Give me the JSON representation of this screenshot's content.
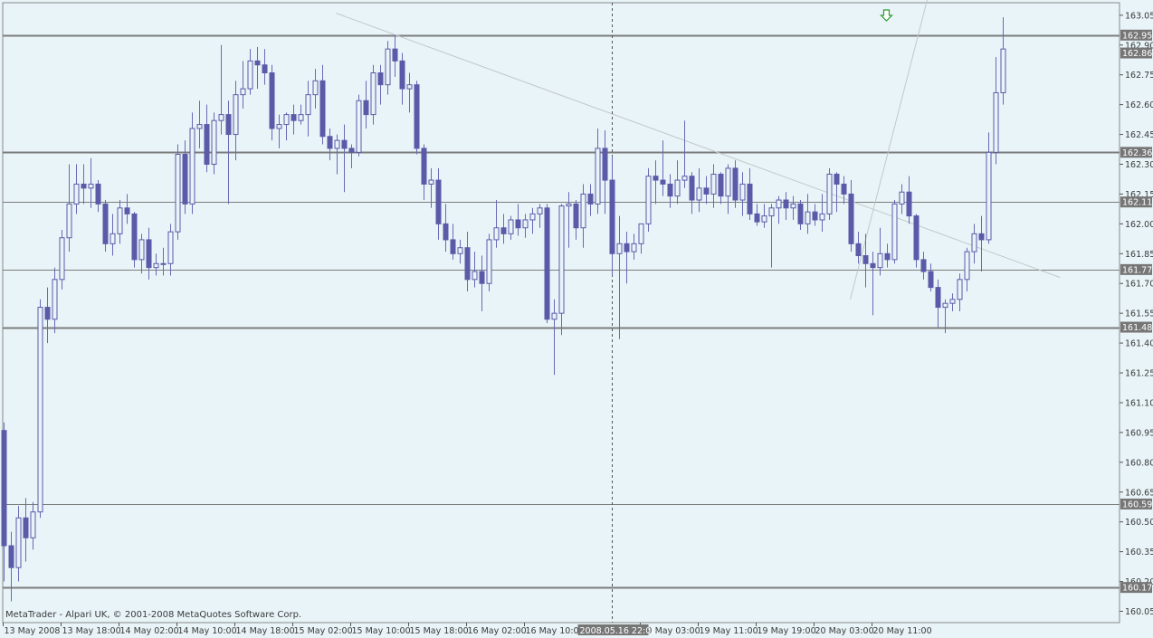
{
  "watermark": "MetaTrader - Alpari UK, © 2001-2008 MetaQuotes Software Corp.",
  "colors": {
    "background": "#e8f4f8",
    "candle_outline": "#5a5aa8",
    "wick": "#6a6ab4",
    "bull_fill": "#e8f4f8",
    "bear_fill": "#5a5aa8",
    "hline": "#7c7c7c",
    "trendline": "#c3c8c8",
    "axis_text": "#3a3a3a",
    "price_tag_bg": "#767676",
    "price_tag_text": "#ffffff",
    "time_tag_bg": "#767676",
    "arrow": "#2f9a2f"
  },
  "chart_data": {
    "type": "candlestick",
    "symbol_timeframe": "",
    "y_axis_ticks": [
      "163.05",
      "162.90",
      "162.75",
      "162.60",
      "162.45",
      "162.30",
      "162.15",
      "162.00",
      "161.85",
      "161.70",
      "161.55",
      "161.40",
      "161.25",
      "161.10",
      "160.95",
      "160.80",
      "160.65",
      "160.50",
      "160.35",
      "160.20",
      "160.05"
    ],
    "ylim": [
      159.993,
      163.113
    ],
    "x_axis_labels": [
      {
        "bar": 0,
        "label": "13 May 2008"
      },
      {
        "bar": 8,
        "label": "13 May 18:00"
      },
      {
        "bar": 16,
        "label": "14 May 02:00"
      },
      {
        "bar": 24,
        "label": "14 May 10:00"
      },
      {
        "bar": 32,
        "label": "14 May 18:00"
      },
      {
        "bar": 40,
        "label": "15 May 02:00"
      },
      {
        "bar": 48,
        "label": "15 May 10:00"
      },
      {
        "bar": 56,
        "label": "15 May 18:00"
      },
      {
        "bar": 64,
        "label": "16 May 02:00"
      },
      {
        "bar": 72,
        "label": "16 May 10:00"
      },
      {
        "bar": 88,
        "label": "19 May 03:00"
      },
      {
        "bar": 96,
        "label": "19 May 11:00"
      },
      {
        "bar": 104,
        "label": "19 May 19:00"
      },
      {
        "bar": 112,
        "label": "20 May 03:00"
      },
      {
        "bar": 120,
        "label": "20 May 11:00"
      }
    ],
    "crosshair": {
      "bar": 84,
      "label": "2008.05.16 22:00"
    },
    "horizontal_lines": [
      {
        "price": 162.95,
        "label": "162.95",
        "bold": true
      },
      {
        "price": 162.36,
        "label": "162.36",
        "bold": true
      },
      {
        "price": 162.11,
        "label": "162.11",
        "bold": false
      },
      {
        "price": 161.77,
        "label": "161.77",
        "bold": false
      },
      {
        "price": 161.48,
        "label": "161.48",
        "bold": true
      },
      {
        "price": 160.59,
        "label": "160.59",
        "bold": false
      },
      {
        "price": 160.17,
        "label": "160.17",
        "bold": true
      }
    ],
    "current_price": {
      "price": 162.86,
      "label": "162.86"
    },
    "trendlines": [
      {
        "from": {
          "bar": 46,
          "price": 163.06
        },
        "to": {
          "bar": 146,
          "price": 161.73
        }
      },
      {
        "from": {
          "bar": 117,
          "price": 161.62
        },
        "to": {
          "bar": 128,
          "price": 163.18
        }
      }
    ],
    "arrow": {
      "bar": 122,
      "price": 163.04,
      "direction": "down"
    },
    "candles": [
      [
        160.96,
        161.0,
        160.2,
        160.38
      ],
      [
        160.38,
        160.45,
        160.1,
        160.27
      ],
      [
        160.27,
        160.58,
        160.2,
        160.52
      ],
      [
        160.52,
        160.62,
        160.3,
        160.42
      ],
      [
        160.42,
        160.6,
        160.36,
        160.55
      ],
      [
        160.55,
        161.62,
        160.52,
        161.58
      ],
      [
        161.58,
        161.68,
        161.4,
        161.52
      ],
      [
        161.52,
        161.78,
        161.45,
        161.72
      ],
      [
        161.72,
        161.97,
        161.67,
        161.93
      ],
      [
        161.93,
        162.3,
        161.86,
        162.1
      ],
      [
        162.1,
        162.3,
        162.05,
        162.2
      ],
      [
        162.2,
        162.3,
        162.1,
        162.18
      ],
      [
        162.18,
        162.33,
        162.08,
        162.2
      ],
      [
        162.2,
        162.22,
        162.06,
        162.1
      ],
      [
        162.1,
        162.12,
        161.86,
        161.9
      ],
      [
        161.9,
        162.05,
        161.84,
        161.95
      ],
      [
        161.95,
        162.12,
        161.9,
        162.08
      ],
      [
        162.08,
        162.15,
        162.0,
        162.05
      ],
      [
        162.05,
        162.06,
        161.78,
        161.82
      ],
      [
        161.82,
        161.95,
        161.75,
        161.92
      ],
      [
        161.92,
        161.98,
        161.72,
        161.78
      ],
      [
        161.78,
        161.85,
        161.74,
        161.8
      ],
      [
        161.8,
        161.88,
        161.74,
        161.8
      ],
      [
        161.8,
        162.0,
        161.74,
        161.96
      ],
      [
        161.96,
        162.4,
        161.92,
        162.35
      ],
      [
        162.35,
        162.42,
        162.05,
        162.1
      ],
      [
        162.1,
        162.56,
        162.05,
        162.48
      ],
      [
        162.48,
        162.62,
        162.38,
        162.5
      ],
      [
        162.5,
        162.6,
        162.26,
        162.3
      ],
      [
        162.3,
        162.56,
        162.25,
        162.52
      ],
      [
        162.52,
        162.9,
        162.45,
        162.55
      ],
      [
        162.55,
        162.62,
        162.1,
        162.45
      ],
      [
        162.45,
        162.72,
        162.32,
        162.65
      ],
      [
        162.65,
        162.82,
        162.58,
        162.68
      ],
      [
        162.68,
        162.88,
        162.65,
        162.82
      ],
      [
        162.82,
        162.89,
        162.68,
        162.8
      ],
      [
        162.8,
        162.88,
        162.7,
        162.76
      ],
      [
        162.76,
        162.8,
        162.42,
        162.48
      ],
      [
        162.48,
        162.55,
        162.38,
        162.5
      ],
      [
        162.5,
        162.56,
        162.42,
        162.55
      ],
      [
        162.55,
        162.6,
        162.45,
        162.52
      ],
      [
        162.52,
        162.6,
        162.5,
        162.55
      ],
      [
        162.55,
        162.72,
        162.44,
        162.65
      ],
      [
        162.65,
        162.78,
        162.58,
        162.72
      ],
      [
        162.72,
        162.8,
        162.4,
        162.44
      ],
      [
        162.44,
        162.48,
        162.32,
        162.38
      ],
      [
        162.38,
        162.45,
        162.25,
        162.42
      ],
      [
        162.42,
        162.5,
        162.16,
        162.38
      ],
      [
        162.38,
        162.4,
        162.28,
        162.36
      ],
      [
        162.36,
        162.65,
        162.34,
        162.62
      ],
      [
        162.62,
        162.72,
        162.48,
        162.55
      ],
      [
        162.55,
        162.8,
        162.5,
        162.76
      ],
      [
        162.76,
        162.8,
        162.6,
        162.7
      ],
      [
        162.7,
        162.92,
        162.65,
        162.88
      ],
      [
        162.88,
        162.95,
        162.74,
        162.82
      ],
      [
        162.82,
        162.86,
        162.6,
        162.68
      ],
      [
        162.68,
        162.76,
        162.56,
        162.7
      ],
      [
        162.7,
        162.72,
        162.35,
        162.38
      ],
      [
        162.38,
        162.4,
        162.12,
        162.2
      ],
      [
        162.2,
        162.28,
        162.08,
        162.22
      ],
      [
        162.22,
        162.28,
        161.92,
        162.0
      ],
      [
        162.0,
        162.1,
        161.86,
        161.92
      ],
      [
        161.92,
        162.0,
        161.82,
        161.85
      ],
      [
        161.85,
        161.92,
        161.8,
        161.88
      ],
      [
        161.88,
        161.96,
        161.66,
        161.72
      ],
      [
        161.72,
        161.86,
        161.68,
        161.76
      ],
      [
        161.76,
        161.84,
        161.56,
        161.7
      ],
      [
        161.7,
        161.95,
        161.66,
        161.92
      ],
      [
        161.92,
        162.12,
        161.88,
        161.98
      ],
      [
        161.98,
        162.05,
        161.9,
        161.95
      ],
      [
        161.95,
        162.04,
        161.92,
        162.02
      ],
      [
        162.02,
        162.1,
        161.94,
        161.98
      ],
      [
        161.98,
        162.05,
        161.93,
        162.02
      ],
      [
        162.02,
        162.08,
        161.95,
        162.05
      ],
      [
        162.05,
        162.1,
        161.98,
        162.08
      ],
      [
        162.08,
        162.1,
        161.5,
        161.52
      ],
      [
        161.52,
        161.62,
        161.24,
        161.55
      ],
      [
        161.55,
        162.1,
        161.44,
        162.09
      ],
      [
        162.09,
        162.16,
        161.88,
        162.1
      ],
      [
        162.1,
        162.12,
        161.92,
        161.98
      ],
      [
        161.98,
        162.2,
        161.88,
        162.15
      ],
      [
        162.15,
        162.2,
        162.04,
        162.1
      ],
      [
        162.1,
        162.48,
        162.05,
        162.38
      ],
      [
        162.38,
        162.47,
        162.05,
        162.22
      ],
      [
        162.22,
        162.34,
        161.74,
        161.85
      ],
      [
        161.85,
        162.04,
        161.42,
        161.9
      ],
      [
        161.9,
        161.96,
        161.7,
        161.86
      ],
      [
        161.86,
        161.95,
        161.82,
        161.9
      ],
      [
        161.9,
        162.0,
        161.85,
        162.0
      ],
      [
        162.0,
        162.28,
        161.96,
        162.24
      ],
      [
        162.24,
        162.32,
        162.1,
        162.22
      ],
      [
        162.22,
        162.42,
        162.14,
        162.2
      ],
      [
        162.2,
        162.25,
        162.08,
        162.14
      ],
      [
        162.14,
        162.32,
        162.1,
        162.22
      ],
      [
        162.22,
        162.52,
        162.18,
        162.24
      ],
      [
        162.24,
        162.26,
        162.05,
        162.12
      ],
      [
        162.12,
        162.28,
        162.06,
        162.18
      ],
      [
        162.18,
        162.24,
        162.1,
        162.15
      ],
      [
        162.15,
        162.3,
        162.08,
        162.25
      ],
      [
        162.25,
        162.26,
        162.1,
        162.14
      ],
      [
        162.14,
        162.3,
        162.05,
        162.28
      ],
      [
        162.28,
        162.32,
        162.08,
        162.12
      ],
      [
        162.12,
        162.26,
        162.04,
        162.2
      ],
      [
        162.2,
        162.28,
        162.02,
        162.05
      ],
      [
        162.05,
        162.1,
        161.99,
        162.01
      ],
      [
        162.01,
        162.1,
        161.98,
        162.04
      ],
      [
        162.04,
        162.1,
        161.78,
        162.08
      ],
      [
        162.08,
        162.14,
        162.0,
        162.12
      ],
      [
        162.12,
        162.16,
        162.02,
        162.08
      ],
      [
        162.08,
        162.14,
        162.02,
        162.1
      ],
      [
        162.1,
        162.12,
        161.97,
        162.0
      ],
      [
        162.0,
        162.15,
        161.95,
        162.06
      ],
      [
        162.06,
        162.1,
        161.99,
        162.02
      ],
      [
        162.02,
        162.15,
        161.96,
        162.05
      ],
      [
        162.05,
        162.28,
        162.02,
        162.25
      ],
      [
        162.25,
        162.26,
        162.06,
        162.2
      ],
      [
        162.2,
        162.24,
        162.1,
        162.15
      ],
      [
        162.15,
        162.22,
        161.86,
        161.9
      ],
      [
        161.9,
        161.96,
        161.8,
        161.84
      ],
      [
        161.84,
        161.95,
        161.68,
        161.8
      ],
      [
        161.8,
        161.86,
        161.54,
        161.78
      ],
      [
        161.78,
        161.98,
        161.74,
        161.85
      ],
      [
        161.85,
        161.9,
        161.78,
        161.82
      ],
      [
        161.82,
        162.12,
        161.8,
        162.1
      ],
      [
        162.1,
        162.2,
        162.05,
        162.16
      ],
      [
        162.16,
        162.24,
        162.0,
        162.04
      ],
      [
        162.04,
        162.05,
        161.78,
        161.82
      ],
      [
        161.82,
        161.86,
        161.72,
        161.76
      ],
      [
        161.76,
        161.8,
        161.66,
        161.68
      ],
      [
        161.68,
        161.72,
        161.48,
        161.58
      ],
      [
        161.58,
        161.62,
        161.45,
        161.6
      ],
      [
        161.6,
        161.65,
        161.56,
        161.62
      ],
      [
        161.62,
        161.75,
        161.56,
        161.72
      ],
      [
        161.72,
        161.88,
        161.66,
        161.86
      ],
      [
        161.86,
        162.0,
        161.8,
        161.95
      ],
      [
        161.95,
        162.04,
        161.76,
        161.92
      ],
      [
        161.92,
        162.46,
        161.9,
        162.36
      ],
      [
        162.36,
        162.84,
        162.3,
        162.66
      ],
      [
        162.66,
        163.04,
        162.6,
        162.88
      ]
    ]
  }
}
